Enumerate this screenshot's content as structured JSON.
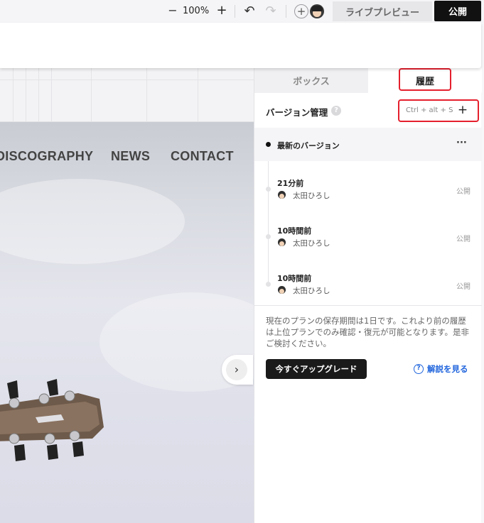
{
  "toolbar": {
    "zoom_out_icon": "minus-icon",
    "zoom_level": "100%",
    "zoom_in_icon": "plus-icon",
    "undo_icon": "undo-icon",
    "redo_icon": "redo-icon",
    "add_icon": "add-circle-icon",
    "preview_label": "ライブプレビュー",
    "publish_label": "公開"
  },
  "site": {
    "nav": [
      "DISCOGRAPHY",
      "NEWS",
      "CONTACT"
    ],
    "slider_next_symbol": "›"
  },
  "history_panel": {
    "tabs": {
      "box": "ボックス",
      "history": "履歴"
    },
    "header_title": "バージョン管理",
    "help_symbol": "?",
    "shortcut": "Ctrl + alt + S",
    "add_symbol": "+",
    "latest_label": "最新のバージョン",
    "more_symbol": "···",
    "entries": [
      {
        "time": "21分前",
        "user": "太田ひろし",
        "status": "公開"
      },
      {
        "time": "10時間前",
        "user": "太田ひろし",
        "status": "公開"
      },
      {
        "time": "10時間前",
        "user": "太田ひろし",
        "status": "公開"
      }
    ],
    "notice": "現在のプランの保存期間は1日です。これより前の履歴は上位プランでのみ確認・復元が可能となります。是非ご検討ください。",
    "upgrade_label": "今すぐアップグレード",
    "guide_label": "解説を見る",
    "guide_symbol": "?"
  },
  "colors": {
    "highlight": "#e5202e",
    "link": "#2266dd",
    "primary_button": "#1a1a1a"
  }
}
